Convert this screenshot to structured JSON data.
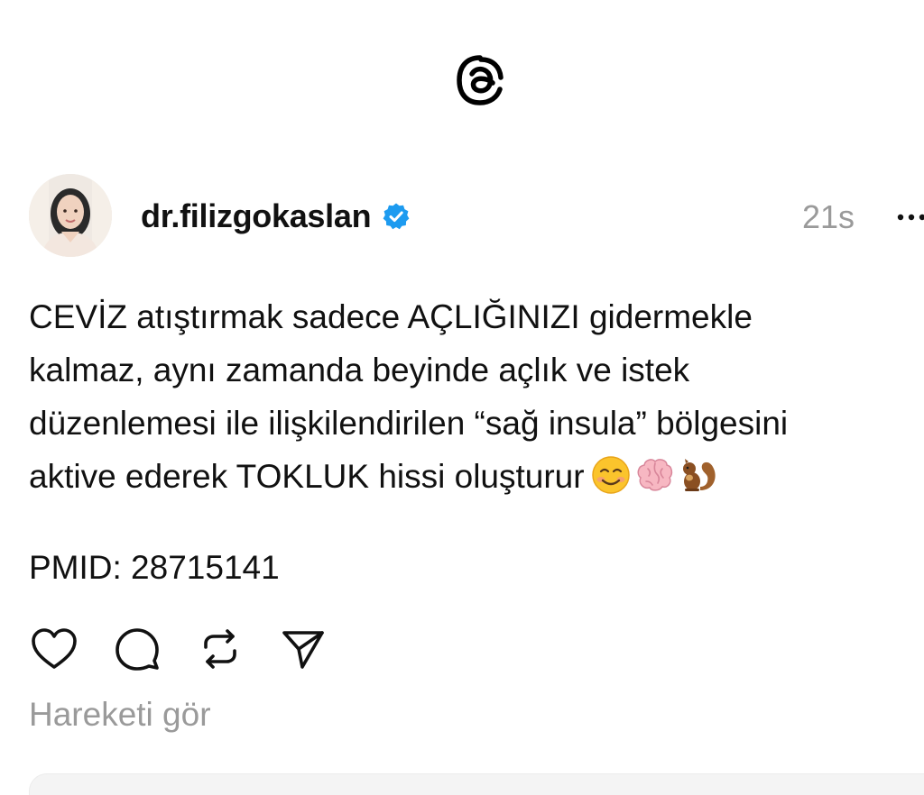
{
  "app": {
    "logo_icon": "threads-logo-icon"
  },
  "post": {
    "author": {
      "username": "dr.filizgokaslan",
      "verified": true,
      "verified_color": "#1d9bf0"
    },
    "timestamp": "21s",
    "body": "CEVİZ atıştırmak sadece AÇLIĞINIZI gidermekle\nkalmaz, aynı zamanda beyinde açlık ve istek\ndüzenlemesi ile ilişkilendirilen “sağ insula” bölgesini\naktive ederek TOKLUK hissi oluşturur",
    "body_emojis": [
      "smiling-face-icon",
      "brain-icon",
      "squirrel-icon"
    ],
    "reference": "PMID: 28715141",
    "actions": [
      "heart-icon",
      "comment-icon",
      "repost-icon",
      "share-icon"
    ],
    "activity_link": "Hareketi gör"
  }
}
